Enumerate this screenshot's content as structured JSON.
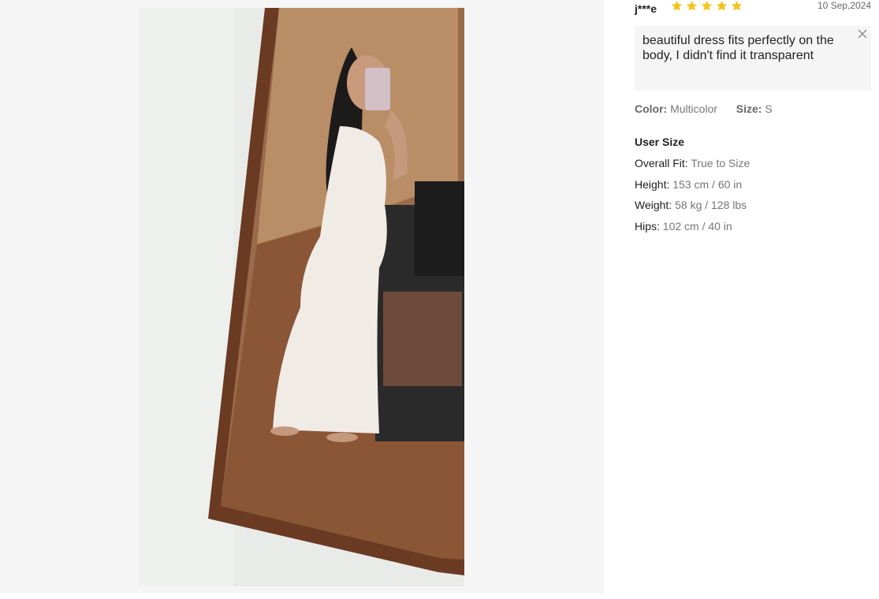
{
  "review": {
    "reviewer_name": "j***e",
    "rating": 5,
    "date": "10 Sep,2024",
    "text": "beautiful dress fits perfectly on the body, I didn't find it transparent",
    "color_label": "Color:",
    "color_value": "Multicolor",
    "size_label": "Size:",
    "size_value": "S"
  },
  "user_size": {
    "title": "User Size",
    "rows": [
      {
        "label": "Overall Fit:",
        "value": "True to Size"
      },
      {
        "label": "Height:",
        "value": "153 cm / 60 in"
      },
      {
        "label": "Weight:",
        "value": "58 kg / 128 lbs"
      },
      {
        "label": "Hips:",
        "value": "102 cm / 40 in"
      }
    ]
  },
  "icons": {
    "star": "star-icon",
    "close": "close-icon"
  },
  "colors": {
    "star": "#f7c21a",
    "viewer_bg": "#f5f5f5",
    "review_box_bg": "#f5f5f5"
  }
}
